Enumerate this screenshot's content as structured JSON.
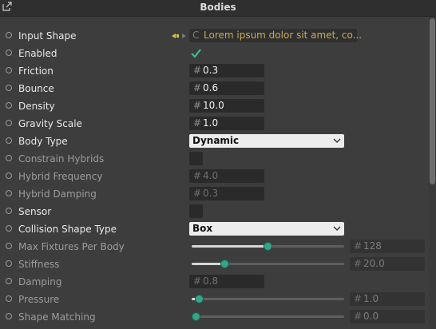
{
  "panel": {
    "title": "Bodies"
  },
  "rows": {
    "input_shape": {
      "label": "Input Shape",
      "type_glyph": "C",
      "value": "Lorem ipsum dolor sit amet, co..."
    },
    "enabled": {
      "label": "Enabled",
      "checked": true
    },
    "friction": {
      "label": "Friction",
      "hash": "#",
      "value": "0.3"
    },
    "bounce": {
      "label": "Bounce",
      "hash": "#",
      "value": "0.6"
    },
    "density": {
      "label": "Density",
      "hash": "#",
      "value": "10.0"
    },
    "gravity_scale": {
      "label": "Gravity Scale",
      "hash": "#",
      "value": "1.0"
    },
    "body_type": {
      "label": "Body Type",
      "value": "Dynamic"
    },
    "constrain_hybrids": {
      "label": "Constrain Hybrids",
      "checked": false
    },
    "hybrid_frequency": {
      "label": "Hybrid Frequency",
      "hash": "#",
      "value": "4.0"
    },
    "hybrid_damping": {
      "label": "Hybrid Damping",
      "hash": "#",
      "value": "0.3"
    },
    "sensor": {
      "label": "Sensor",
      "checked": false
    },
    "collision_shape_type": {
      "label": "Collision Shape Type",
      "value": "Box"
    },
    "max_fixtures": {
      "label": "Max Fixtures Per Body",
      "hash": "#",
      "value": "128",
      "slider_fraction": 0.5
    },
    "stiffness": {
      "label": "Stiffness",
      "hash": "#",
      "value": "20.0",
      "slider_fraction": 0.2
    },
    "damping": {
      "label": "Damping",
      "hash": "#",
      "value": "0.8"
    },
    "pressure": {
      "label": "Pressure",
      "hash": "#",
      "value": "1.0",
      "slider_fraction": 0.02
    },
    "shape_matching": {
      "label": "Shape Matching",
      "hash": "#",
      "value": "0.0",
      "slider_fraction": 0.0
    }
  },
  "colors": {
    "accent": "#35a48a",
    "check": "#35c08a",
    "string_value": "#c9a95a",
    "background": "#3d3d3d"
  },
  "icons": {
    "popout": "popout-icon",
    "connector": "connector-arrow-icon",
    "checkmark": "checkmark-icon",
    "chevron": "chevron-down-icon"
  }
}
